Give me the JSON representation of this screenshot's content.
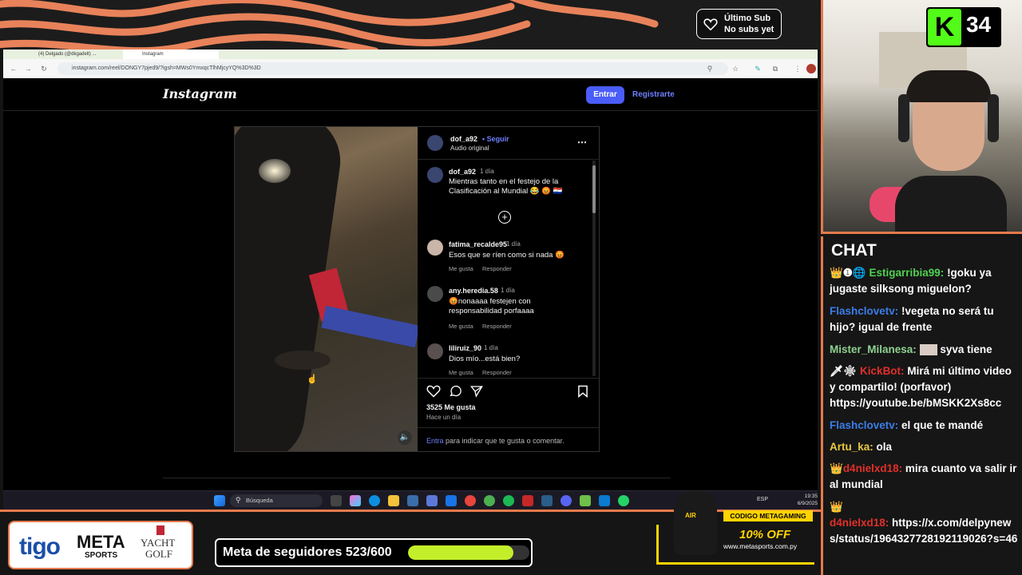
{
  "stream": {
    "sub_title": "Último Sub",
    "sub_value": "No subs yet",
    "k_count": "34",
    "chat_title": "CHAT"
  },
  "browser": {
    "url": "instagram.com/reel/DONGY7pjed9/?igsh=MWs0YmxqcTlhMjcyYQ%3D%3D",
    "tabs": [
      "(4) Delgado (@dkgadelt) ...",
      "Instagram"
    ]
  },
  "instagram": {
    "logo": "Instagram",
    "login_button": "Entrar",
    "register_link": "Registrarte",
    "author": "dof_a92",
    "follow": "• Seguir",
    "audio": "Audio original",
    "caption_time": "1 día",
    "caption": "Mientras tanto en el festejo de la Clasificación al Mundial 😂 😡 🇵🇾",
    "comments": [
      {
        "user": "fatima_recalde95",
        "time": "1 día",
        "text": "Esos que se ríen como si nada 😡",
        "like": "Me gusta",
        "reply": "Responder"
      },
      {
        "user": "any.heredia.58",
        "time": "1 día",
        "text": "😡nonaaaa festejen con responsabilidad porfaaaa",
        "like": "Me gusta",
        "reply": "Responder"
      },
      {
        "user": "liliruiz_90",
        "time": "1 día",
        "text": "Dios mío...está bien?",
        "like": "Me gusta",
        "reply": "Responder"
      }
    ],
    "likes": "3525 Me gusta",
    "posted": "Hace un día",
    "login_prompt_link": "Entra",
    "login_prompt": "para indicar que te gusta o comentar."
  },
  "taskbar": {
    "search_placeholder": "Búsqueda",
    "lang": "ESP",
    "time": "19:35",
    "date": "6/9/2025"
  },
  "chat": [
    {
      "user": "Estigarribia99:",
      "user_color": "#4fd14f",
      "text": "!goku ya jugaste silksong miguelon?",
      "badges": "👑❶🌐"
    },
    {
      "user": "Flashclovetv:",
      "user_color": "#3b7de8",
      "text": "!vegeta no será tu hijo? igual de frente",
      "badges": ""
    },
    {
      "user": "Mister_Milanesa:",
      "user_color": "#8fd18f",
      "text": "syva tiene",
      "badges": ""
    },
    {
      "user": "KickBot:",
      "user_color": "#e0302a",
      "text": "Mirá mi último video y compartilo! (porfavor) https://youtube.be/bMSKK2Xs8cc",
      "badges": "🗡❇"
    },
    {
      "user": "Flashclovetv:",
      "user_color": "#3b7de8",
      "text": "el que te mandé",
      "badges": ""
    },
    {
      "user": "Artu_ka:",
      "user_color": "#e8c940",
      "text": "ola",
      "badges": ""
    },
    {
      "user": "d4nielxd18:",
      "user_color": "#e0302a",
      "text": "mira cuanto va salir ir al mundial",
      "badges": "👑"
    },
    {
      "user": "d4nielxd18:",
      "user_color": "#e0302a",
      "text": "https://x.com/delpynews/status/1964327728192119026?s=46",
      "badges": "👑"
    }
  ],
  "overlay": {
    "sponsor_tigo": "tigo",
    "sponsor_meta": "META",
    "sponsor_meta_sub": "SPORTS",
    "sponsor_yacht": "YACHT",
    "sponsor_golf": "GOLF",
    "goal_label": "Meta de seguidores 523/600",
    "goal_current": 523,
    "goal_target": 600,
    "promo_code": "CODIGO METAGAMING",
    "promo_offer": "10% OFF",
    "promo_site": "www.metasports.com.py",
    "bag_brand": "AIR"
  },
  "colors": {
    "accent": "#e57a4c",
    "ig_blue": "#4a5df9",
    "goal_fill": "#c3ef2a",
    "promo_yellow": "#ffd400"
  }
}
